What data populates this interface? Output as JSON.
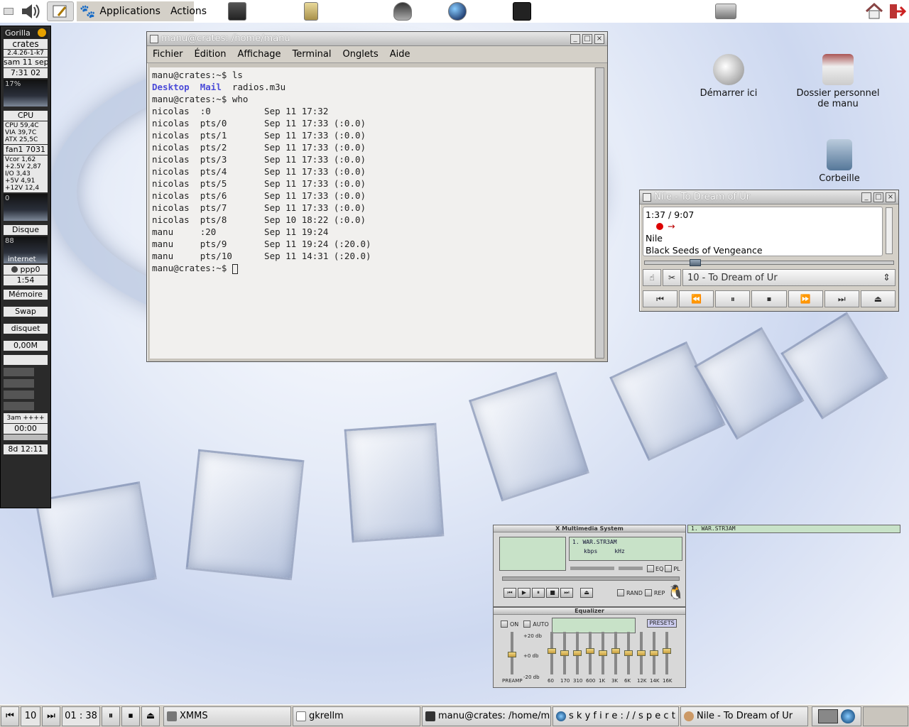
{
  "top_panel": {
    "menu_applications": "Applications",
    "menu_actions": "Actions",
    "icons": [
      "volume-icon",
      "notes-icon",
      "gnome-foot-icon",
      "monitor-icon",
      "filing-cabinet-icon",
      "penguin-icon",
      "globe-icon",
      "terminal-arch-icon",
      "camera-icon",
      "home-icon",
      "logout-icon"
    ]
  },
  "gkrellm": {
    "theme": "Gorilla",
    "host": "crates",
    "kernel": "2.4.26-1-k7",
    "date": "sam 11 sep",
    "time": "7:31 02",
    "cpu_load": "17%",
    "cpu_label": "CPU",
    "temps": [
      "CPU 59,4C",
      "VIA 39,7C",
      "ATX 25,5C"
    ],
    "fan": "fan1 7031",
    "volts": [
      "Vcor 1,62",
      "+2.5V 2,87",
      "I/O 3,43",
      "+5V 4,91",
      "+12V 12,4"
    ],
    "proc_count": "0",
    "disk_label": "Disque",
    "disk_val": "88",
    "internet_label": "internet",
    "net_iface": "ppp0",
    "net_time": "1:54",
    "mem_label": "Mémoire",
    "swap_label": "Swap",
    "fs_label": "disquet",
    "mail_label": "0,00M",
    "mixer_label": "3am ++++",
    "clock_small": "00:00",
    "uptime": "8d 12:11"
  },
  "terminal": {
    "title": "manu@crates: /home/manu",
    "menu": [
      "Fichier",
      "Édition",
      "Affichage",
      "Terminal",
      "Onglets",
      "Aide"
    ],
    "prompt1": "manu@crates:~$ ls",
    "ls_dirs": [
      "Desktop",
      "Mail"
    ],
    "ls_file": "radios.m3u",
    "prompt2": "manu@crates:~$ who",
    "who_lines": [
      "nicolas  :0          Sep 11 17:32",
      "nicolas  pts/0       Sep 11 17:33 (:0.0)",
      "nicolas  pts/1       Sep 11 17:33 (:0.0)",
      "nicolas  pts/2       Sep 11 17:33 (:0.0)",
      "nicolas  pts/3       Sep 11 17:33 (:0.0)",
      "nicolas  pts/4       Sep 11 17:33 (:0.0)",
      "nicolas  pts/5       Sep 11 17:33 (:0.0)",
      "nicolas  pts/6       Sep 11 17:33 (:0.0)",
      "nicolas  pts/7       Sep 11 17:33 (:0.0)",
      "nicolas  pts/8       Sep 10 18:22 (:0.0)",
      "manu     :20         Sep 11 19:24",
      "manu     pts/9       Sep 11 19:24 (:20.0)",
      "manu     pts/10      Sep 11 14:31 (:20.0)"
    ],
    "prompt3": "manu@crates:~$ "
  },
  "desktop_icons": [
    {
      "name": "start-here",
      "label": "Démarrer ici"
    },
    {
      "name": "home-folder",
      "label": "Dossier personnel de manu"
    },
    {
      "name": "trash",
      "label": "Corbeille"
    }
  ],
  "nile": {
    "title": "Nile - To Dream of Ur",
    "time": "1:37 / 9:07",
    "artist": "Nile",
    "album": "Black Seeds of Vengeance",
    "track_select": "10 - To Dream of Ur",
    "seek_fraction": 0.18
  },
  "xmms": {
    "title": "X Multimedia System",
    "song": "1. WAR.STR3AM",
    "kbps": "kbps",
    "khz": "kHz",
    "eq": "EQ",
    "pl": "PL",
    "rand": "RAND",
    "rep": "REP",
    "eq_title": "Equalizer",
    "eq_on": "ON",
    "eq_auto": "AUTO",
    "presets": "PRESETS",
    "db_plus": "+20 db",
    "db_zero": "+0 db",
    "db_minus": "-20 db",
    "preamp": "PREAMP",
    "bands": [
      "60",
      "170",
      "310",
      "600",
      "1K",
      "3K",
      "6K",
      "12K",
      "14K",
      "16K"
    ],
    "playlist_title": "1. WAR.STR3AM"
  },
  "bottom_panel": {
    "track_num": "10",
    "time": "01 : 38",
    "tasks": [
      {
        "name": "task-xmms",
        "label": "XMMS"
      },
      {
        "name": "task-gkrellm",
        "label": "gkrellm"
      },
      {
        "name": "task-terminal",
        "label": "manu@crates: /home/m"
      },
      {
        "name": "task-skyfire",
        "label": "s k y f i r e : / / s p e c t r"
      },
      {
        "name": "task-nile",
        "label": "Nile - To Dream of Ur"
      }
    ]
  }
}
